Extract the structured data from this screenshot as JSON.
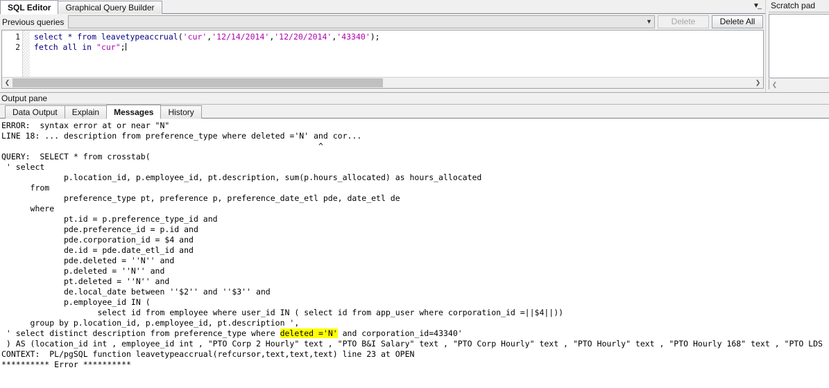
{
  "editor_tabs": [
    {
      "label": "SQL Editor",
      "active": true
    },
    {
      "label": "Graphical Query Builder",
      "active": false
    }
  ],
  "tabstrip": {
    "overflow_icon": "chevron-down-double-icon"
  },
  "previous_queries": {
    "label": "Previous queries",
    "value": "",
    "placeholder": "",
    "dropdown_icon": "chevron-down-icon",
    "delete_label": "Delete",
    "delete_all_label": "Delete All",
    "delete_enabled": false
  },
  "sql_editor": {
    "line_numbers": [
      "1",
      "2"
    ],
    "lines": [
      [
        {
          "t": "select * from leavetypeaccrual",
          "c": "kw"
        },
        {
          "t": "(",
          "c": "plain"
        },
        {
          "t": "'cur'",
          "c": "str"
        },
        {
          "t": ",",
          "c": "plain"
        },
        {
          "t": "'12/14/2014'",
          "c": "str"
        },
        {
          "t": ",",
          "c": "plain"
        },
        {
          "t": "'12/20/2014'",
          "c": "str"
        },
        {
          "t": ",",
          "c": "plain"
        },
        {
          "t": "'43340'",
          "c": "str"
        },
        {
          "t": ");",
          "c": "plain"
        }
      ],
      [
        {
          "t": "fetch all in ",
          "c": "kw"
        },
        {
          "t": "\"cur\"",
          "c": "str"
        },
        {
          "t": ";",
          "c": "plain"
        }
      ]
    ],
    "scroll_left_icon": "chevron-left-icon",
    "scroll_right_icon": "chevron-right-icon",
    "hscroll_thumb_percent": 50
  },
  "scratch_pad": {
    "title": "Scratch pad",
    "content": "",
    "scroll_left_icon": "chevron-left-icon"
  },
  "output_pane": {
    "title": "Output pane",
    "tabs": [
      {
        "label": "Data Output",
        "active": false
      },
      {
        "label": "Explain",
        "active": false
      },
      {
        "label": "Messages",
        "active": true
      },
      {
        "label": "History",
        "active": false
      }
    ]
  },
  "messages": {
    "highlight_color": "#ffff00",
    "lines": [
      {
        "text": "ERROR:  syntax error at or near \"N\""
      },
      {
        "text": "LINE 18: ... description from preference_type where deleted ='N' and cor..."
      },
      {
        "text": "                                                                  ^"
      },
      {
        "text": "QUERY:  SELECT * from crosstab("
      },
      {
        "text": " ' select"
      },
      {
        "text": "             p.location_id, p.employee_id, pt.description, sum(p.hours_allocated) as hours_allocated"
      },
      {
        "text": "      from"
      },
      {
        "text": "             preference_type pt, preference p, preference_date_etl pde, date_etl de"
      },
      {
        "text": "      where"
      },
      {
        "text": "             pt.id = p.preference_type_id and"
      },
      {
        "text": "             pde.preference_id = p.id and"
      },
      {
        "text": "             pde.corporation_id = $4 and"
      },
      {
        "text": "             de.id = pde.date_etl_id and"
      },
      {
        "text": "             pde.deleted = ''N'' and"
      },
      {
        "text": "             p.deleted = ''N'' and"
      },
      {
        "text": "             pt.deleted = ''N'' and"
      },
      {
        "text": "             de.local_date between ''$2'' and ''$3'' and"
      },
      {
        "text": "             p.employee_id IN ("
      },
      {
        "text": "                    select id from employee where user_id IN ( select id from app_user where corporation_id =||$4||))"
      },
      {
        "text": "      group by p.location_id, p.employee_id, pt.description ',"
      },
      {
        "segments": [
          {
            "t": " ' select distinct description from preference_type where "
          },
          {
            "t": "deleted ='N'",
            "hl": true
          },
          {
            "t": " and corporation_id=43340'"
          }
        ]
      },
      {
        "text": " ) AS (location_id int , employee_id int , \"PTO Corp 2 Hourly\" text , \"PTO B&I Salary\" text , \"PTO Corp Hourly\" text , \"PTO Hourly\" text , \"PTO Hourly 168\" text , \"PTO LDS"
      },
      {
        "text": "CONTEXT:  PL/pgSQL function leavetypeaccrual(refcursor,text,text,text) line 23 at OPEN"
      },
      {
        "text": "********** Error **********"
      }
    ]
  }
}
